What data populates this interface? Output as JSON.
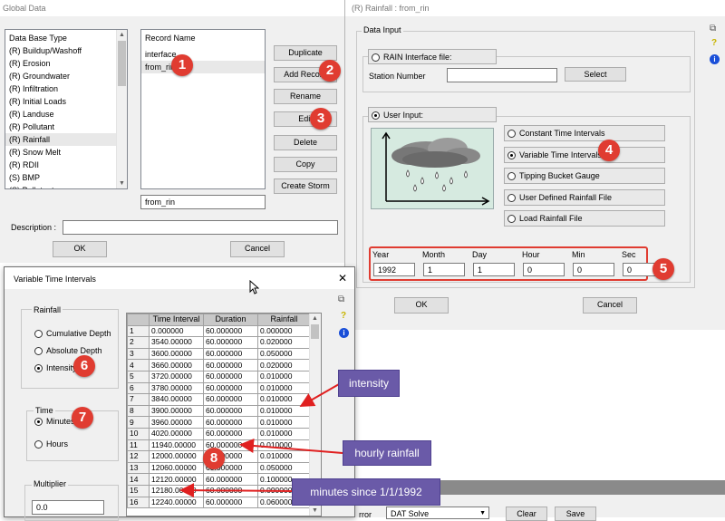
{
  "global_data": {
    "title": "Global Data",
    "db_type_header": "Data Base Type",
    "db_types": [
      "(R) Buildup/Washoff",
      "(R) Erosion",
      "(R) Groundwater",
      "(R) Infiltration",
      "(R) Initial Loads",
      "(R) Landuse",
      "(R) Pollutant",
      "(R) Rainfall",
      "(R) Snow Melt",
      "(R) RDII",
      "(S) BMP",
      "(S) Pollutant"
    ],
    "db_selected_index": 7,
    "record_header": "Record Name",
    "records": [
      "interface",
      "from_rin"
    ],
    "record_selected_index": 1,
    "record_name_value": "from_rin",
    "buttons": {
      "duplicate": "Duplicate",
      "add": "Add Record",
      "rename": "Rename",
      "edit": "Edit",
      "delete": "Delete",
      "copy": "Copy",
      "create_storm": "Create Storm"
    },
    "description_label": "Description :",
    "description_value": "",
    "ok": "OK",
    "cancel": "Cancel"
  },
  "rainfall": {
    "title": "(R) Rainfall : from_rin",
    "data_input_label": "Data Input",
    "rain_file_label": "RAIN Interface file:",
    "station_label": "Station Number",
    "station_value": "",
    "select_label": "Select",
    "user_input_label": "User Input:",
    "options": [
      "Constant Time Intervals",
      "Variable Time Intervals",
      "Tipping Bucket Gauge",
      "User Defined Rainfall File",
      "Load Rainfall File"
    ],
    "selected_option": 1,
    "date_fields": [
      {
        "label": "Year",
        "value": "1992"
      },
      {
        "label": "Month",
        "value": "1"
      },
      {
        "label": "Day",
        "value": "1"
      },
      {
        "label": "Hour",
        "value": "0"
      },
      {
        "label": "Min",
        "value": "0"
      },
      {
        "label": "Sec",
        "value": "0"
      }
    ],
    "ok": "OK",
    "cancel": "Cancel"
  },
  "vti": {
    "title": "Variable Time Intervals",
    "close_glyph": "✕",
    "rainfall_group": "Rainfall",
    "rainfall_options": [
      "Cumulative Depth",
      "Absolute Depth",
      "Intensity"
    ],
    "rainfall_selected": 2,
    "time_group": "Time",
    "time_options": [
      "Minutes",
      "Hours"
    ],
    "time_selected": 0,
    "multiplier_group": "Multiplier",
    "multiplier_value": "0.0",
    "columns": [
      "Time Interval",
      "Duration",
      "Rainfall"
    ],
    "rows": [
      [
        "1",
        "0.000000",
        "60.000000",
        "0.000000"
      ],
      [
        "2",
        "3540.00000",
        "60.000000",
        "0.020000"
      ],
      [
        "3",
        "3600.00000",
        "60.000000",
        "0.050000"
      ],
      [
        "4",
        "3660.00000",
        "60.000000",
        "0.020000"
      ],
      [
        "5",
        "3720.00000",
        "60.000000",
        "0.010000"
      ],
      [
        "6",
        "3780.00000",
        "60.000000",
        "0.010000"
      ],
      [
        "7",
        "3840.00000",
        "60.000000",
        "0.010000"
      ],
      [
        "8",
        "3900.00000",
        "60.000000",
        "0.010000"
      ],
      [
        "9",
        "3960.00000",
        "60.000000",
        "0.010000"
      ],
      [
        "10",
        "4020.00000",
        "60.000000",
        "0.010000"
      ],
      [
        "11",
        "11940.00000",
        "60.000000",
        "0.010000"
      ],
      [
        "12",
        "12000.00000",
        "60.000000",
        "0.010000"
      ],
      [
        "13",
        "12060.00000",
        "60.000000",
        "0.050000"
      ],
      [
        "14",
        "12120.00000",
        "60.000000",
        "0.100000"
      ],
      [
        "15",
        "12180.00000",
        "60.000000",
        "0.090000"
      ],
      [
        "16",
        "12240.00000",
        "60.000000",
        "0.060000"
      ]
    ]
  },
  "bottom_bar": {
    "error_label": "rror",
    "solver_value": "DAT Solve",
    "clear": "Clear",
    "save": "Save"
  },
  "annotations": {
    "badges": [
      "1",
      "2",
      "3",
      "4",
      "5",
      "6",
      "7",
      "8"
    ],
    "callouts": {
      "intensity": "intensity",
      "hourly": "hourly rainfall",
      "minutes": "minutes since 1/1/1992"
    },
    "colors": {
      "badge": "#e03c31",
      "callout": "#6a5aa8",
      "arrow": "#e02020",
      "highlight": "#e03c31"
    }
  }
}
